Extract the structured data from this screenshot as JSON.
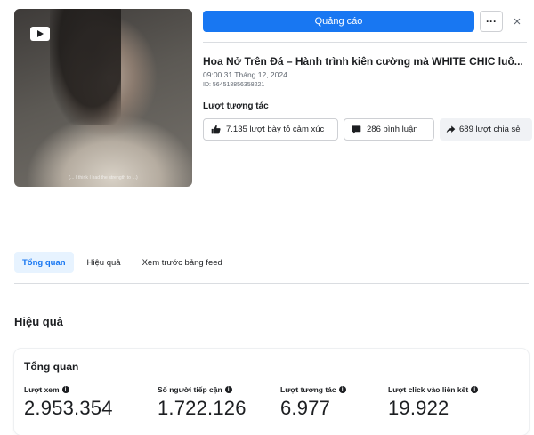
{
  "thumbnail": {
    "subtitle_text": "(... I think I had the strength to ...)"
  },
  "header": {
    "promote_label": "Quảng cáo",
    "more_label": "···",
    "close_label": "×"
  },
  "post": {
    "title": "Hoa Nở Trên Đá – Hành trình kiên cường mà WHITE CHIC luô...",
    "time": "09:00 31 Tháng 12, 2024",
    "id": "ID: 564518856358221"
  },
  "interactions": {
    "label": "Lượt tương tác",
    "reactions": "7.135 lượt bày tỏ cảm xúc",
    "comments": "286 bình luận",
    "shares": "689 lượt chia sẻ"
  },
  "tabs": [
    {
      "label": "Tổng quan",
      "active": true
    },
    {
      "label": "Hiệu quả",
      "active": false
    },
    {
      "label": "Xem trước bảng feed",
      "active": false
    }
  ],
  "performance": {
    "section_title": "Hiệu quả",
    "overview_title": "Tổng quan",
    "metrics": [
      {
        "label": "Lượt xem",
        "value": "2.953.354"
      },
      {
        "label": "Số người tiếp cận",
        "value": "1.722.126"
      },
      {
        "label": "Lượt tương tác",
        "value": "6.977"
      },
      {
        "label": "Lượt click vào liên kết",
        "value": "19.922"
      }
    ]
  },
  "colors": {
    "accent": "#1877f2",
    "accent_light": "#e7f3ff",
    "text": "#1c1e21",
    "muted": "#606770",
    "border": "#ced0d4"
  }
}
